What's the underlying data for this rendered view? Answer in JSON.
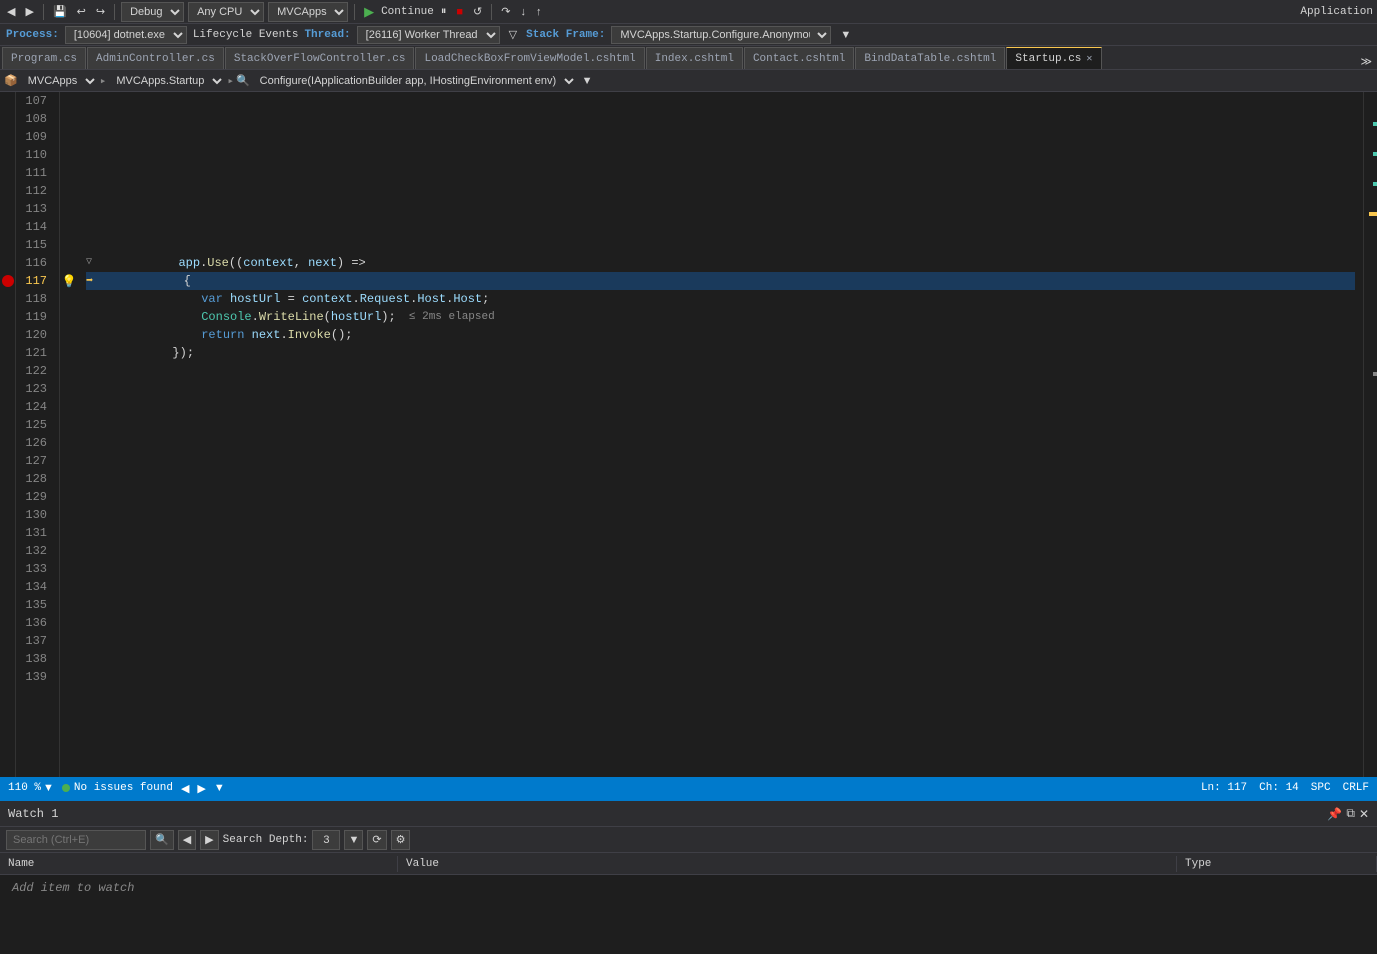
{
  "toolbar": {
    "debug_label": "Debug",
    "cpu_label": "Any CPU",
    "project_label": "MVCApps",
    "continue_label": "Continue",
    "application_label": "Application"
  },
  "process_bar": {
    "process_label": "Process:",
    "process_value": "[10604] dotnet.exe",
    "lifecycle_label": "Lifecycle Events",
    "thread_label": "Thread:",
    "thread_value": "[26116] Worker Thread",
    "stack_frame_label": "Stack Frame:",
    "stack_frame_value": "MVCApps.Startup.Configure.Anonymous<"
  },
  "tabs": [
    {
      "id": "program",
      "label": "Program.cs",
      "active": false,
      "modified": false
    },
    {
      "id": "admin",
      "label": "AdminController.cs",
      "active": false,
      "modified": false
    },
    {
      "id": "stackoverflow",
      "label": "StackOverFlowController.cs",
      "active": false,
      "modified": false
    },
    {
      "id": "loadcheckbox",
      "label": "LoadCheckBoxFromViewModel.cshtml",
      "active": false,
      "modified": false
    },
    {
      "id": "index",
      "label": "Index.cshtml",
      "active": false,
      "modified": false
    },
    {
      "id": "contact",
      "label": "Contact.cshtml",
      "active": false,
      "modified": false
    },
    {
      "id": "binddatatable",
      "label": "BindDataTable.cshtml",
      "active": false,
      "modified": false
    },
    {
      "id": "startup",
      "label": "Startup.cs",
      "active": true,
      "modified": false
    }
  ],
  "breadcrumb": {
    "namespace": "MVCApps",
    "class": "MVCApps.Startup",
    "method": "Configure(IApplicationBuilder app, IHostingEnvironment env)"
  },
  "code": {
    "lines": [
      {
        "num": 107,
        "content": "",
        "type": "plain"
      },
      {
        "num": 108,
        "content": "",
        "type": "plain"
      },
      {
        "num": 109,
        "content": "",
        "type": "plain"
      },
      {
        "num": 110,
        "content": "",
        "type": "plain"
      },
      {
        "num": 111,
        "content": "",
        "type": "plain"
      },
      {
        "num": 112,
        "content": "",
        "type": "plain"
      },
      {
        "num": 113,
        "content": "",
        "type": "plain"
      },
      {
        "num": 114,
        "content": "",
        "type": "plain"
      },
      {
        "num": 115,
        "content": "",
        "type": "plain"
      },
      {
        "num": 116,
        "content": "            app.Use((context, next) =>",
        "type": "code",
        "has_collapse": true
      },
      {
        "num": 117,
        "content": "            {",
        "type": "code",
        "is_current": true,
        "has_breakpoint": true,
        "has_lightbulb": true
      },
      {
        "num": 118,
        "content": "                var hostUrl = context.Request.Host.Host;",
        "type": "code"
      },
      {
        "num": 119,
        "content": "                Console.WriteLine(hostUrl);",
        "type": "code",
        "has_time": true,
        "time_text": "≤ 2ms elapsed"
      },
      {
        "num": 120,
        "content": "                return next.Invoke();",
        "type": "code"
      },
      {
        "num": 121,
        "content": "            });",
        "type": "code"
      },
      {
        "num": 122,
        "content": "",
        "type": "plain"
      },
      {
        "num": 123,
        "content": "",
        "type": "plain"
      },
      {
        "num": 124,
        "content": "",
        "type": "plain"
      },
      {
        "num": 125,
        "content": "",
        "type": "plain"
      },
      {
        "num": 126,
        "content": "",
        "type": "plain"
      },
      {
        "num": 127,
        "content": "",
        "type": "plain"
      },
      {
        "num": 128,
        "content": "",
        "type": "plain"
      },
      {
        "num": 129,
        "content": "",
        "type": "plain"
      },
      {
        "num": 130,
        "content": "",
        "type": "plain"
      },
      {
        "num": 131,
        "content": "",
        "type": "plain"
      },
      {
        "num": 132,
        "content": "",
        "type": "plain"
      },
      {
        "num": 133,
        "content": "",
        "type": "plain"
      },
      {
        "num": 134,
        "content": "",
        "type": "plain"
      },
      {
        "num": 135,
        "content": "",
        "type": "plain"
      },
      {
        "num": 136,
        "content": "",
        "type": "plain"
      },
      {
        "num": 137,
        "content": "",
        "type": "plain"
      },
      {
        "num": 138,
        "content": "",
        "type": "plain"
      },
      {
        "num": 139,
        "content": "",
        "type": "plain"
      }
    ]
  },
  "status_bar": {
    "zoom": "110 %",
    "issues_label": "No issues found",
    "line": "Ln: 117",
    "col": "Ch: 14",
    "encoding": "SPC",
    "line_ending": "CRLF"
  },
  "watch_panel": {
    "title": "Watch 1",
    "search_placeholder": "Search (Ctrl+E)",
    "search_depth_label": "Search Depth:",
    "search_depth_value": "3",
    "columns": {
      "name": "Name",
      "value": "Value",
      "type": "Type"
    },
    "add_item_text": "Add item to watch"
  }
}
